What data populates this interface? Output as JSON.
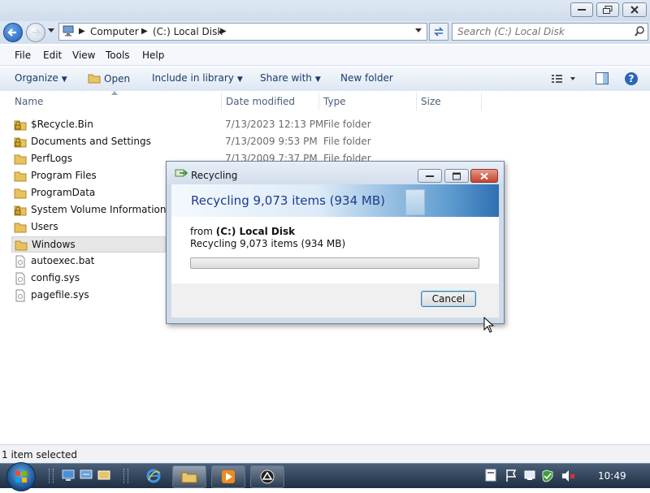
{
  "window": {
    "controls": [
      "minimize-icon",
      "maximize-icon",
      "close-icon"
    ]
  },
  "address": {
    "crumbs": [
      "Computer",
      "(C:) Local Disk"
    ],
    "search_placeholder": "Search (C:) Local Disk"
  },
  "menu": {
    "file": "File",
    "edit": "Edit",
    "view": "View",
    "tools": "Tools",
    "help": "Help"
  },
  "commands": {
    "organize": "Organize",
    "open": "Open",
    "include": "Include in library",
    "share": "Share with",
    "new_folder": "New folder"
  },
  "columns": {
    "name": "Name",
    "date": "Date modified",
    "type": "Type",
    "size": "Size"
  },
  "files": [
    {
      "name": "$Recycle.Bin",
      "date": "7/13/2023 12:13 PM",
      "type": "File folder",
      "icon": "locked-folder-icon"
    },
    {
      "name": "Documents and Settings",
      "date": "7/13/2009 9:53 PM",
      "type": "File folder",
      "icon": "locked-folder-icon"
    },
    {
      "name": "PerfLogs",
      "date": "7/13/2009 7:37 PM",
      "type": "File folder",
      "icon": "folder-icon"
    },
    {
      "name": "Program Files",
      "icon": "folder-icon"
    },
    {
      "name": "ProgramData",
      "icon": "folder-icon"
    },
    {
      "name": "System Volume Information",
      "icon": "locked-folder-icon"
    },
    {
      "name": "Users",
      "icon": "folder-icon"
    },
    {
      "name": "Windows",
      "icon": "folder-icon",
      "selected": true
    },
    {
      "name": "autoexec.bat",
      "icon": "file-icon"
    },
    {
      "name": "config.sys",
      "icon": "file-icon"
    },
    {
      "name": "pagefile.sys",
      "icon": "file-icon"
    }
  ],
  "status": {
    "text": "1 item selected"
  },
  "dialog": {
    "title": "Recycling",
    "heading": "Recycling 9,073 items (934 MB)",
    "from_prefix": "from ",
    "from_location": "(C:) Local Disk",
    "detail": "Recycling 9,073 items (934 MB)",
    "progress": 0,
    "cancel": "Cancel"
  },
  "taskbar": {
    "clock": "10:49",
    "pinned": [
      "start-orb",
      "desktop-icon",
      "network-icon",
      "ie-icon",
      "explorer-icon",
      "media-player-icon",
      "app-icon"
    ]
  },
  "colors": {
    "accent": "#1e3a8a",
    "progress": "#3fb12c"
  }
}
